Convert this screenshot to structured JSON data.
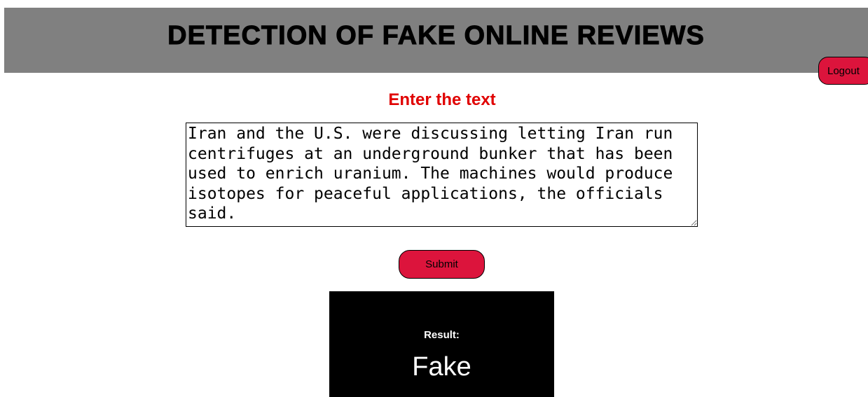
{
  "header": {
    "title": "DETECTION OF FAKE ONLINE REVIEWS"
  },
  "nav": {
    "logout_label": "Logout"
  },
  "form": {
    "prompt": "Enter the text",
    "text_value": "Iran and the U.S. were discussing letting Iran run centrifuges at an underground bunker that has been used to enrich uranium. The machines would produce isotopes for peaceful applications, the officials said.",
    "submit_label": "Submit"
  },
  "result": {
    "label": "Result:",
    "value": "Fake"
  },
  "colors": {
    "header_bg": "#808080",
    "accent_button": "#dc143c",
    "prompt_text": "#e00000",
    "result_bg": "#000000",
    "result_text": "#ffffff"
  }
}
